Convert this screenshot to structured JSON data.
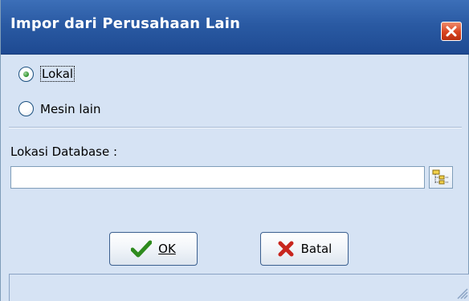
{
  "window": {
    "title": "Impor dari Perusahaan Lain",
    "close_icon": "close-icon"
  },
  "source_options": [
    {
      "label": "Lokal",
      "selected": true
    },
    {
      "label": "Mesin lain",
      "selected": false
    }
  ],
  "database": {
    "label": "Lokasi Database :",
    "value": "",
    "browse_icon": "folder-tree-icon"
  },
  "buttons": {
    "ok_label": "OK",
    "cancel_label": "Batal"
  },
  "colors": {
    "titlebar": "#2a5aa3",
    "background": "#d6e3f4",
    "close": "#d8431f",
    "ok_check": "#2e8b1e",
    "cancel_x": "#c8261e"
  }
}
